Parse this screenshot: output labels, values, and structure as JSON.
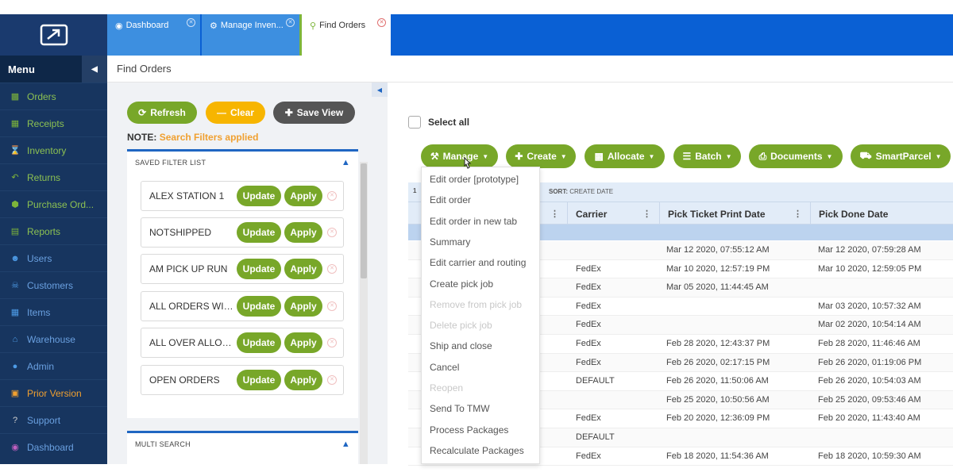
{
  "tabs": [
    {
      "icon": "dashboard-icon",
      "label": "Dashboard"
    },
    {
      "icon": "gears-icon",
      "label": "Manage Inven..."
    },
    {
      "icon": "search-icon",
      "label": "Find Orders"
    }
  ],
  "sidebar": {
    "title": "Menu",
    "items": [
      {
        "label": "Orders",
        "icon": "sitemap-icon"
      },
      {
        "label": "Receipts",
        "icon": "document-icon"
      },
      {
        "label": "Inventory",
        "icon": "hourglass-icon"
      },
      {
        "label": "Returns",
        "icon": "return-arrow-icon"
      },
      {
        "label": "Purchase Ord...",
        "icon": "cube-icon"
      },
      {
        "label": "Reports",
        "icon": "report-icon"
      },
      {
        "label": "Users",
        "icon": "users-icon"
      },
      {
        "label": "Customers",
        "icon": "handshake-icon"
      },
      {
        "label": "Items",
        "icon": "grid-icon"
      },
      {
        "label": "Warehouse",
        "icon": "home-icon"
      },
      {
        "label": "Admin",
        "icon": "user-icon"
      },
      {
        "label": "Prior Version",
        "icon": "archive-icon"
      },
      {
        "label": "Support",
        "icon": "question-icon"
      },
      {
        "label": "Dashboard",
        "icon": "dashboard-icon"
      }
    ]
  },
  "page": {
    "title": "Find Orders"
  },
  "filters": {
    "refresh_label": "Refresh",
    "clear_label": "Clear",
    "save_view_label": "Save View",
    "note_prefix": "NOTE:",
    "note_text": "Search Filters applied",
    "saved_filter_title": "SAVED FILTER LIST",
    "multi_search_title": "MULTI SEARCH",
    "update_label": "Update",
    "apply_label": "Apply",
    "saved": [
      "ALEX STATION 1",
      "NOTSHIPPED",
      "AM PICK UP RUN",
      "ALL ORDERS WITH...",
      "ALL OVER ALLOCA...",
      "OPEN ORDERS"
    ]
  },
  "main": {
    "select_all_label": "Select all",
    "actions": [
      "Manage",
      "Create",
      "Allocate",
      "Batch",
      "Documents",
      "SmartParcel"
    ],
    "grid_info_prefix": "1",
    "sort_label": "SORT:",
    "sort_value": "CREATE DATE",
    "columns": [
      "Carrier",
      "Pick Ticket Print Date",
      "Pick Done Date"
    ],
    "rows": [
      {
        "carrier": "",
        "print": "Mar 12 2020, 07:55:12 AM",
        "done": "Mar 12 2020, 07:59:28 AM"
      },
      {
        "carrier": "FedEx",
        "print": "Mar 10 2020, 12:57:19 PM",
        "done": "Mar 10 2020, 12:59:05 PM"
      },
      {
        "carrier": "FedEx",
        "print": "Mar 05 2020, 11:44:45 AM",
        "done": ""
      },
      {
        "carrier": "FedEx",
        "print": "",
        "done": "Mar 03 2020, 10:57:32 AM"
      },
      {
        "carrier": "FedEx",
        "print": "",
        "done": "Mar 02 2020, 10:54:14 AM"
      },
      {
        "carrier": "FedEx",
        "print": "Feb 28 2020, 12:43:37 PM",
        "done": "Feb 28 2020, 11:46:46 AM"
      },
      {
        "carrier": "FedEx",
        "print": "Feb 26 2020, 02:17:15 PM",
        "done": "Feb 26 2020, 01:19:06 PM"
      },
      {
        "carrier": "DEFAULT",
        "print": "Feb 26 2020, 11:50:06 AM",
        "done": "Feb 26 2020, 10:54:03 AM"
      },
      {
        "carrier": "",
        "print": "Feb 25 2020, 10:50:56 AM",
        "done": "Feb 25 2020, 09:53:46 AM"
      },
      {
        "carrier": "FedEx",
        "print": "Feb 20 2020, 12:36:09 PM",
        "done": "Feb 20 2020, 11:43:40 AM"
      },
      {
        "carrier": "DEFAULT",
        "print": "",
        "done": ""
      },
      {
        "carrier": "FedEx",
        "print": "Feb 18 2020, 11:54:36 AM",
        "done": "Feb 18 2020, 10:59:30 AM"
      }
    ]
  },
  "manage_menu": [
    {
      "label": "Edit order [prototype]",
      "enabled": true
    },
    {
      "label": "Edit order",
      "enabled": true
    },
    {
      "label": "Edit order in new tab",
      "enabled": true
    },
    {
      "label": "Summary",
      "enabled": true
    },
    {
      "label": "Edit carrier and routing",
      "enabled": true
    },
    {
      "label": "Create pick job",
      "enabled": true
    },
    {
      "label": "Remove from pick job",
      "enabled": false
    },
    {
      "label": "Delete pick job",
      "enabled": false
    },
    {
      "label": "Ship and close",
      "enabled": true
    },
    {
      "label": "Cancel",
      "enabled": true
    },
    {
      "label": "Reopen",
      "enabled": false
    },
    {
      "label": "Send To TMW",
      "enabled": true
    },
    {
      "label": "Process Packages",
      "enabled": true
    },
    {
      "label": "Recalculate Packages",
      "enabled": true
    }
  ],
  "colors": {
    "brand_blue": "#0a60d4",
    "sidebar": "#17355f",
    "accent_green": "#78a729",
    "clear_orange": "#f7b500",
    "save_gray": "#555555"
  }
}
